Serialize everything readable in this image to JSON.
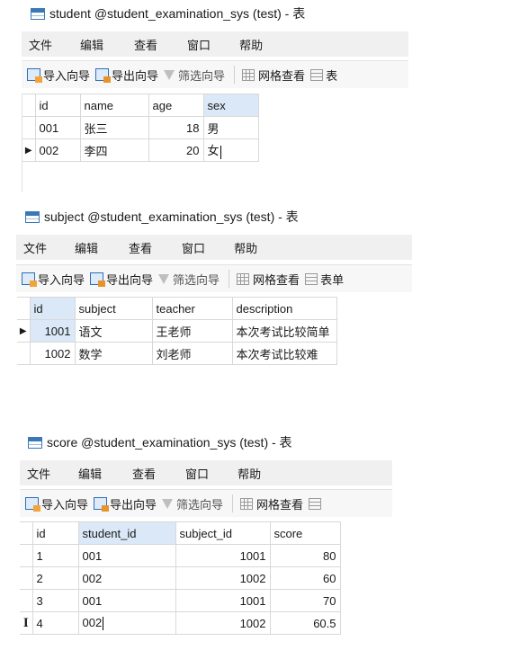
{
  "menu": [
    "文件",
    "编辑",
    "查看",
    "窗口",
    "帮助"
  ],
  "toolbar": {
    "import": "导入向导",
    "export": "导出向导",
    "filter": "筛选向导",
    "grid": "网格查看",
    "form1": "表",
    "form2": "表单"
  },
  "student": {
    "title": "student @student_examination_sys (test) - 表",
    "columns": [
      "id",
      "name",
      "age",
      "sex"
    ],
    "rows": [
      [
        "001",
        "张三",
        "18",
        "男"
      ],
      [
        "002",
        "李四",
        "20",
        "女"
      ]
    ]
  },
  "subject": {
    "title": "subject @student_examination_sys (test) - 表",
    "columns": [
      "id",
      "subject",
      "teacher",
      "description"
    ],
    "rows": [
      [
        "1001",
        "语文",
        "王老师",
        "本次考试比较简单"
      ],
      [
        "1002",
        "数学",
        "刘老师",
        "本次考试比较难"
      ]
    ]
  },
  "score": {
    "title": "score @student_examination_sys (test) - 表",
    "columns": [
      "id",
      "student_id",
      "subject_id",
      "score"
    ],
    "rows": [
      [
        "1",
        "001",
        "1001",
        "80"
      ],
      [
        "2",
        "002",
        "1002",
        "60"
      ],
      [
        "3",
        "001",
        "1001",
        "70"
      ],
      [
        "4",
        "002",
        "1002",
        "60.5"
      ]
    ]
  },
  "icons": {
    "row_pointer": "row-pointer-icon",
    "text_cursor": "text-cursor-icon"
  }
}
